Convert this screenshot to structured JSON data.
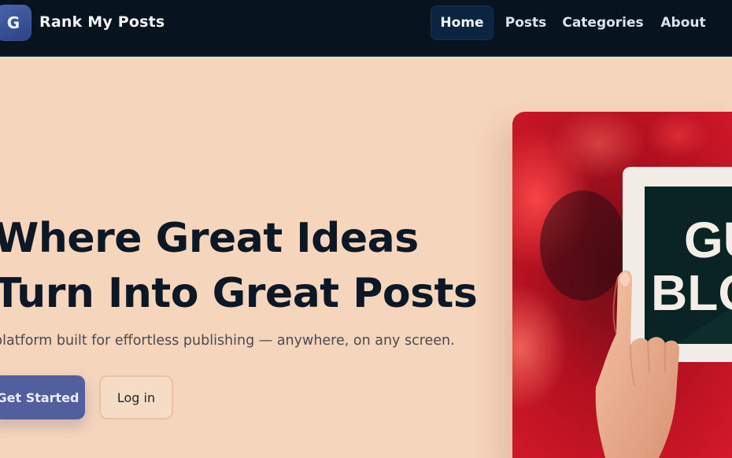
{
  "brand": {
    "logo_letter": "G",
    "name": "Rank My Posts"
  },
  "nav": {
    "items": [
      {
        "label": "Home",
        "active": true
      },
      {
        "label": "Posts",
        "active": false
      },
      {
        "label": "Categories",
        "active": false
      },
      {
        "label": "About",
        "active": false
      }
    ]
  },
  "hero": {
    "title_line1": "Where Great Ideas",
    "title_line2": "Turn Into Great Posts",
    "subtitle": "platform built for effortless publishing — anywhere, on any screen.",
    "primary_button": "Get Started",
    "secondary_button": "Log in",
    "image_sign_line1": "GU",
    "image_sign_line2": "BLO"
  },
  "colors": {
    "nav_background": "#07141f",
    "page_background": "#f5d5bc",
    "accent": "#515f9f",
    "heading": "#0c1826"
  }
}
